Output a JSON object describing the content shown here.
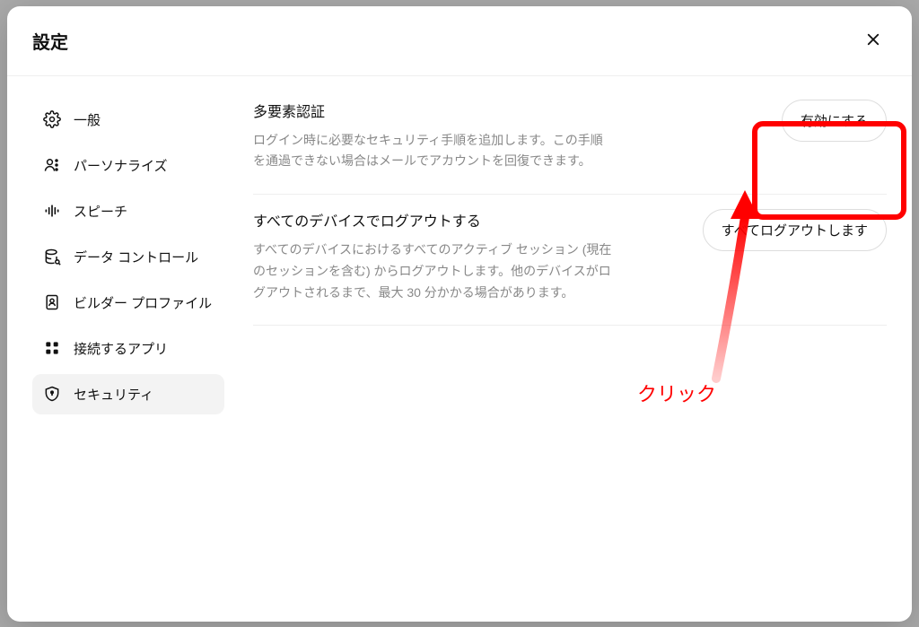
{
  "header": {
    "title": "設定"
  },
  "sidebar": {
    "items": [
      {
        "label": "一般",
        "icon": "gear"
      },
      {
        "label": "パーソナライズ",
        "icon": "person"
      },
      {
        "label": "スピーチ",
        "icon": "sound"
      },
      {
        "label": "データ コントロール",
        "icon": "database"
      },
      {
        "label": "ビルダー プロファイル",
        "icon": "document"
      },
      {
        "label": "接続するアプリ",
        "icon": "grid"
      },
      {
        "label": "セキュリティ",
        "icon": "shield"
      }
    ]
  },
  "content": {
    "mfa": {
      "title": "多要素認証",
      "description": "ログイン時に必要なセキュリティ手順を追加します。この手順を通過できない場合はメールでアカウントを回復できます。",
      "button": "有効にする"
    },
    "logout": {
      "title": "すべてのデバイスでログアウトする",
      "description": "すべてのデバイスにおけるすべてのアクティブ セッション (現在のセッションを含む) からログアウトします。他のデバイスがログアウトされるまで、最大 30 分かかる場合があります。",
      "button": "すべてログアウトします"
    }
  },
  "annotation": {
    "label": "クリック"
  }
}
